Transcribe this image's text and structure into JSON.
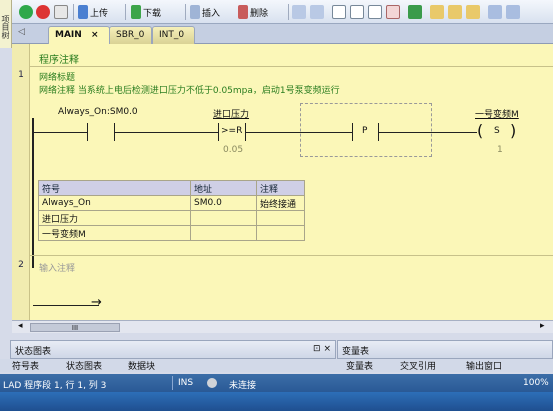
{
  "toolbar": {
    "upload": "上传",
    "download": "下载",
    "insert": "插入",
    "delete": "删除"
  },
  "left_strip": "项目树",
  "tabs": [
    {
      "label": "MAIN",
      "close": "×"
    },
    {
      "label": "SBR_0"
    },
    {
      "label": "INT_0"
    }
  ],
  "program_comment": "程序注释",
  "networks": [
    {
      "number": "1",
      "title": "网络标题",
      "comment": "网络注释 当系统上电后检测进口压力不低于0.05mpa，启动1号泵变频运行",
      "contact1": "Always_On:SM0.0",
      "compare_label": "进口压力",
      "compare_op": ">=R",
      "compare_value": "0.05",
      "p_label": "P",
      "coil_label": "一号变频M",
      "coil_op": "S",
      "coil_value": "1"
    },
    {
      "number": "2",
      "placeholder": "输入注释"
    }
  ],
  "symbol_table": {
    "headers": [
      "符号",
      "地址",
      "注释"
    ],
    "rows": [
      [
        "Always_On",
        "SM0.0",
        "始终接通"
      ],
      [
        "进口压力",
        "",
        ""
      ],
      [
        "一号变频M",
        "",
        ""
      ]
    ]
  },
  "scroll_mark": "III",
  "panes": {
    "status_chart": "状态图表",
    "status_controls": "⊡ × ",
    "variable_table": "变量表"
  },
  "bottom_tabs": [
    "符号表",
    "状态图表",
    "数据块",
    "变量表",
    "交叉引用",
    "输出窗口"
  ],
  "status": {
    "position": "LAD 程序段 1, 行 1, 列 3",
    "mode": "INS",
    "connection": "未连接",
    "zoom": "100%"
  }
}
